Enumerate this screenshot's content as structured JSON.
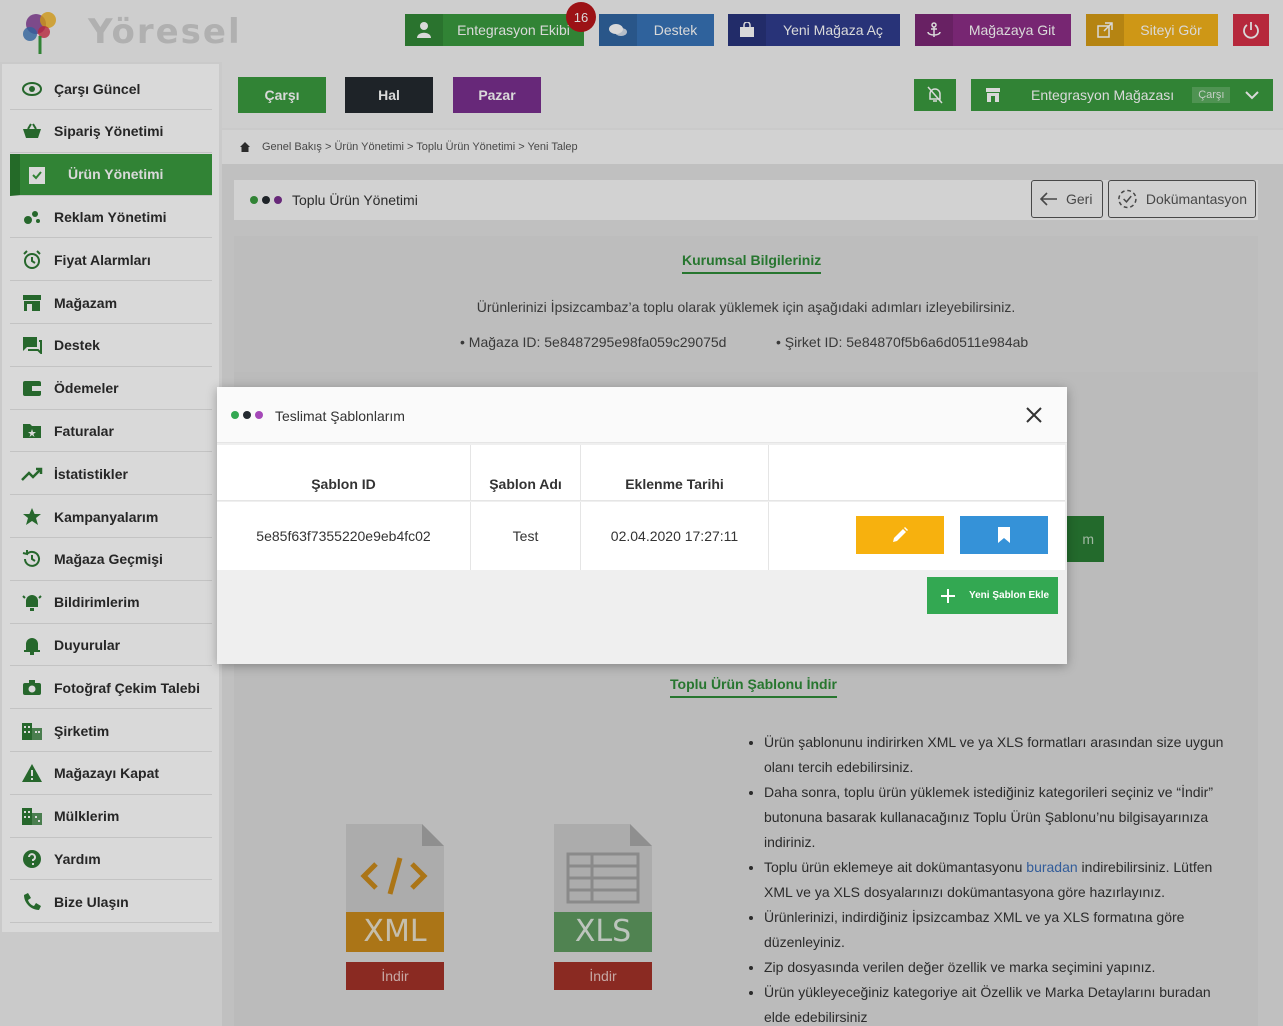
{
  "header": {
    "logo_text": "Yöresel",
    "notification_count": "16",
    "buttons": [
      {
        "label": "Entegrasyon Ekibi",
        "color": "#3a9b3f"
      },
      {
        "label": "Destek",
        "color": "#3874b8"
      },
      {
        "label": "Yeni Mağaza Aç",
        "color": "#2f3c8e"
      },
      {
        "label": "Mağazaya Git",
        "color": "#8c2d86"
      },
      {
        "label": "Siteyi Gör",
        "color": "#f3b21a"
      }
    ],
    "power_color": "#d63047"
  },
  "sidebar": {
    "items": [
      {
        "label": "Çarşı Güncel",
        "icon": "eye-icon"
      },
      {
        "label": "Sipariş Yönetimi",
        "icon": "basket-icon"
      },
      {
        "label": "Ürün Yönetimi",
        "icon": "clipboard-check-icon",
        "active": true
      },
      {
        "label": "Reklam Yönetimi",
        "icon": "bubbles-icon"
      },
      {
        "label": "Fiyat Alarmları",
        "icon": "alarm-clock-icon"
      },
      {
        "label": "Mağazam",
        "icon": "store-icon"
      },
      {
        "label": "Destek",
        "icon": "chat-icon"
      },
      {
        "label": "Ödemeler",
        "icon": "wallet-icon"
      },
      {
        "label": "Faturalar",
        "icon": "folder-star-icon"
      },
      {
        "label": "İstatistikler",
        "icon": "trend-icon"
      },
      {
        "label": "Kampanyalarım",
        "icon": "star-icon"
      },
      {
        "label": "Mağaza Geçmişi",
        "icon": "history-icon"
      },
      {
        "label": "Bildirimlerim",
        "icon": "bell-ring-icon"
      },
      {
        "label": "Duyurular",
        "icon": "bell-icon"
      },
      {
        "label": "Fotoğraf Çekim Talebi",
        "icon": "camera-icon"
      },
      {
        "label": "Şirketim",
        "icon": "building-icon"
      },
      {
        "label": "Mağazayı Kapat",
        "icon": "warning-icon"
      },
      {
        "label": "Mülklerim",
        "icon": "apartment-icon"
      },
      {
        "label": "Yardım",
        "icon": "help-icon"
      },
      {
        "label": "Bize Ulaşın",
        "icon": "phone-icon"
      }
    ]
  },
  "nav": {
    "carsi": "Çarşı",
    "hal": "Hal",
    "pazar": "Pazar",
    "store_select": "Entegrasyon Mağazası",
    "store_tag": "Çarşı"
  },
  "breadcrumb": "Genel Bakış > Ürün Yönetimi > Toplu Ürün Yönetimi > Yeni Talep",
  "panel": {
    "title": "Toplu Ürün Yönetimi",
    "back": "Geri",
    "docs": "Dokümantasyon"
  },
  "corporate": {
    "title": "Kurumsal Bilgileriniz",
    "intro": "Ürünlerinizi İpsizcambaz’a toplu olarak yüklemek için aşağıdaki adımları izleyebilirsiniz.",
    "store_id": "Mağaza ID: 5e8487295e98fa059c29075d",
    "company_id": "Şirket ID: 5e84870f5b6a6d0511e984ab"
  },
  "background_button_fragment": "m",
  "template_download": {
    "title": "Toplu Ürün Şablonu İndir",
    "xml_label": "XML",
    "xls_label": "XLS",
    "download": "İndir",
    "bullets": [
      "Ürün şablonunu indirirken XML ve ya XLS formatları arasından size uygun olanı tercih edebilirsiniz.",
      "Daha sonra, toplu ürün yüklemek istediğiniz kategorileri seçiniz ve “İndir” butonuna basarak kullanacağınız Toplu Ürün Şablonu’nu bilgisayarınıza indiriniz."
    ],
    "bullet3_pre": "Toplu ürün eklemeye ait dokümantasyonu ",
    "bullet3_link": "buradan",
    "bullet3_post": " indirebilirsiniz. Lütfen XML ve ya XLS dosyalarınızı dokümantasyona göre hazırlayınız.",
    "bullets_rest": [
      "Ürünlerinizi, indirdiğiniz İpsizcambaz XML ve ya XLS formatına göre düzenleyiniz.",
      "Zip dosyasında verilen değer özellik ve marka seçimini yapınız.",
      "Ürün yükleyeceğiniz kategoriye ait Özellik ve Marka Detaylarını buradan elde edebilirsiniz"
    ]
  },
  "modal": {
    "title": "Teslimat Şablonlarım",
    "columns": [
      "Şablon ID",
      "Şablon Adı",
      "Eklenme Tarihi",
      ""
    ],
    "rows": [
      {
        "id": "5e85f63f7355220e9eb4fc02",
        "name": "Test",
        "date": "02.04.2020 17:27:11"
      }
    ],
    "add_button": "Yeni Şablon Ekle"
  },
  "colors": {
    "green": "#3a9b3f",
    "dark": "#242a30",
    "purple": "#7a2f8f",
    "edit": "#f7b10e",
    "bookmark": "#3592d8"
  }
}
